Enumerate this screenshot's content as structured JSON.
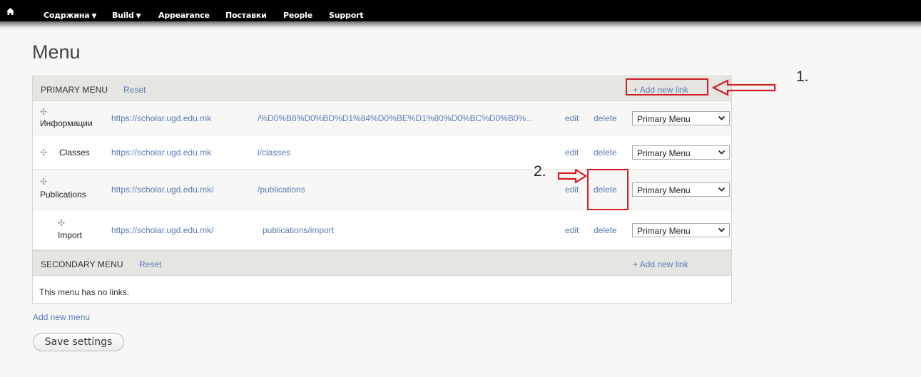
{
  "toolbar": {
    "home_icon": "home-icon",
    "items": [
      {
        "label": "Содржина",
        "has_caret": true
      },
      {
        "label": "Build",
        "has_caret": true
      },
      {
        "label": "Appearance",
        "has_caret": false
      },
      {
        "label": "Поставки",
        "has_caret": false
      },
      {
        "label": "People",
        "has_caret": false
      },
      {
        "label": "Support",
        "has_caret": false
      }
    ],
    "caret": "▼"
  },
  "page": {
    "title": "Menu"
  },
  "primary_menu": {
    "title": "PRIMARY MENU",
    "reset": "Reset",
    "add_link": "+ Add new link",
    "rows": [
      {
        "name": "Информации",
        "url": "https://scholar.ugd.edu.mk",
        "path": "/%D0%B8%D0%BD%D1%84%D0%BE%D1%80%D0%BC%D0%B0%...",
        "edit": "edit",
        "delete": "delete",
        "menu": "Primary Menu"
      },
      {
        "name": "Classes",
        "url": "https://scholar.ugd.edu.mk",
        "path": "i/classes",
        "edit": "edit",
        "delete": "delete",
        "menu": "Primary Menu"
      },
      {
        "name": "Publications",
        "url": "https://scholar.ugd.edu.mk/",
        "path": "/publications",
        "edit": "edit",
        "delete": "delete",
        "menu": "Primary Menu"
      },
      {
        "name": "Import",
        "url": "https://scholar.ugd.edu.mk/",
        "path": "publications/import",
        "edit": "edit",
        "delete": "delete",
        "menu": "Primary Menu"
      }
    ]
  },
  "secondary_menu": {
    "title": "SECONDARY MENU",
    "reset": "Reset",
    "add_link": "+ Add new link",
    "empty_text": "This menu has no links."
  },
  "footer": {
    "add_menu": "Add new menu",
    "save": "Save settings"
  },
  "annotations": {
    "label_1": "1.",
    "label_2": "2.",
    "color": "#d21f25"
  },
  "colors": {
    "link": "#5a7bb5",
    "toolbar": "#000000",
    "header_bg": "#e5e5e2"
  }
}
